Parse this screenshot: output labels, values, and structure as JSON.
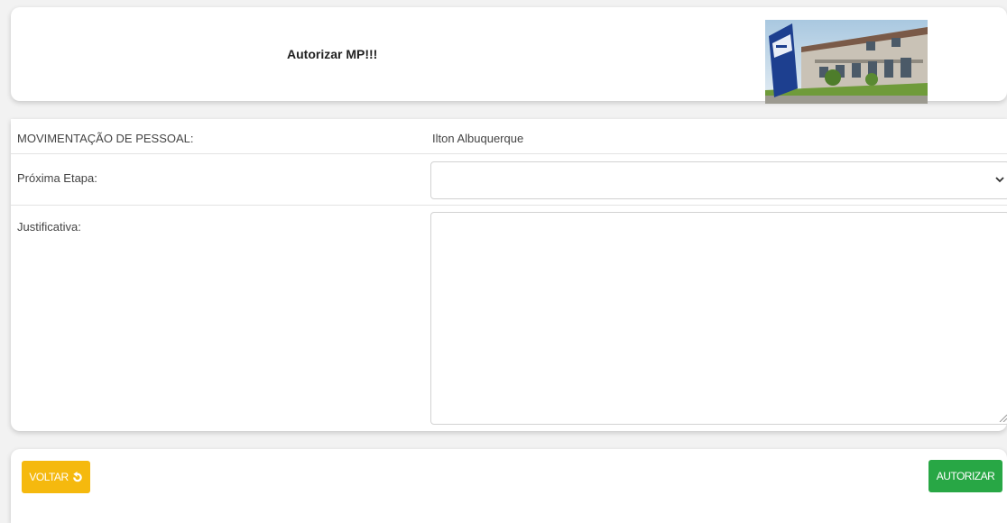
{
  "header": {
    "title": "Autorizar MP!!!",
    "image_alt": "building-photo"
  },
  "form": {
    "movement_label": "MOVIMENTAÇÃO DE PESSOAL:",
    "movement_value": "Ilton Albuquerque",
    "next_step_label": "Próxima Etapa:",
    "next_step_value": "",
    "justification_label": "Justificativa:",
    "justification_value": ""
  },
  "actions": {
    "back_label": "VOLTAR",
    "authorize_label": "AUTORIZAR"
  },
  "colors": {
    "back_button": "#f5b90e",
    "authorize_button": "#28a745",
    "background": "#f2f2f2"
  }
}
